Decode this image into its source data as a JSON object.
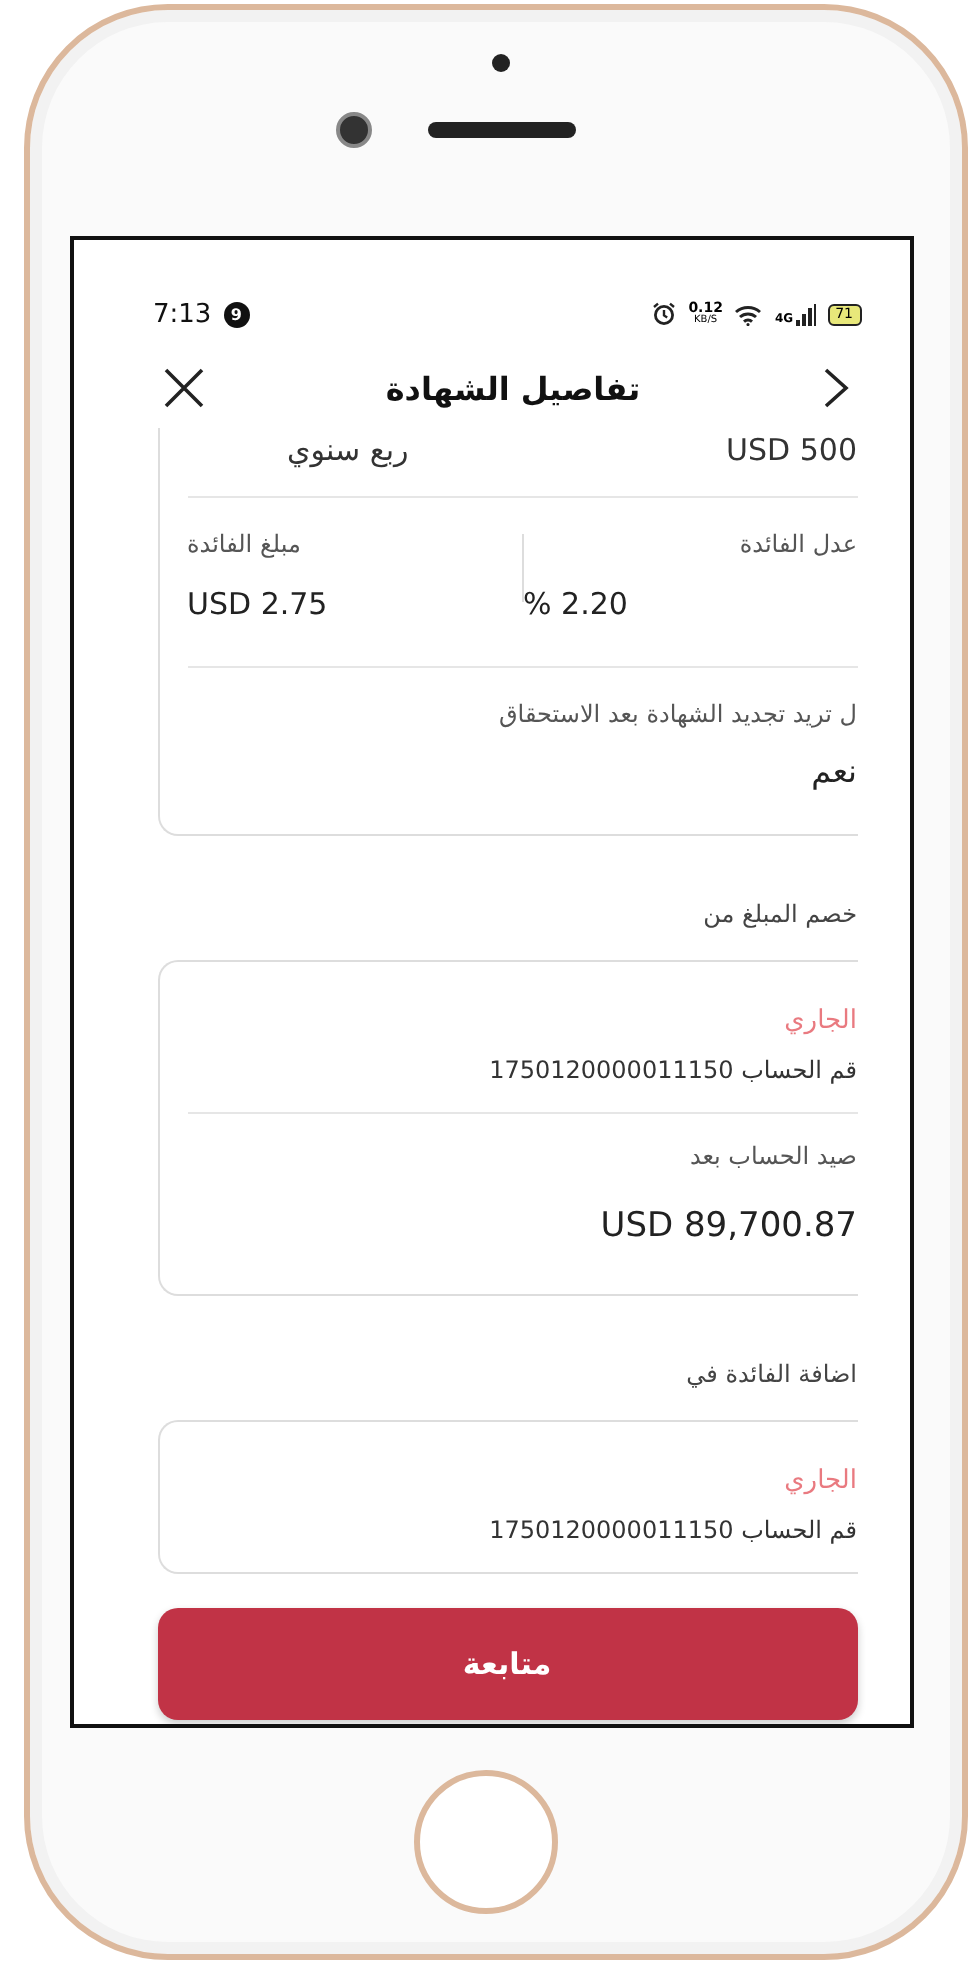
{
  "status_bar": {
    "time": "7:13",
    "notification_count": "9",
    "net_speed": "0.12",
    "net_speed_unit": "KB/S",
    "network": "4G",
    "battery": "71"
  },
  "header": {
    "title": "تفاصيل الشهادة"
  },
  "summary_card": {
    "top_values": [
      "USD 500",
      "ربع سنوي"
    ],
    "pairs": [
      {
        "label": "عدل الفائدة",
        "value": "% 2.20"
      },
      {
        "label": "مبلغ الفائدة",
        "value": "USD 2.75"
      }
    ],
    "question": {
      "label": "ل تريد تجديد الشهادة بعد الاستحقاق",
      "value": "نعم"
    }
  },
  "sections": [
    {
      "title": "خصم المبلغ من",
      "account_type": "الجاري",
      "account_number": "قم الحساب 1750120000011150",
      "balance_label": "صيد الحساب بعد",
      "balance": "USD 89,700.87"
    },
    {
      "title": "اضافة الفائدة في",
      "account_type": "الجاري",
      "account_number": "قم الحساب 1750120000011150"
    }
  ],
  "button": {
    "label": "متابعة"
  }
}
